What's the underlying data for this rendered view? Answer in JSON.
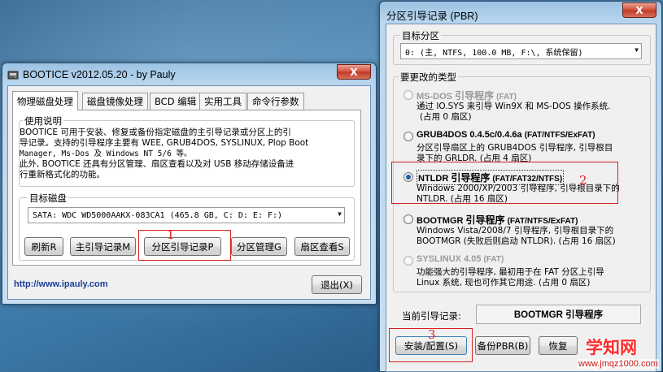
{
  "left_window": {
    "title": "BOOTICE v2012.05.20 - by Pauly",
    "close_label": "X",
    "tabs": [
      "物理磁盘处理",
      "磁盘镜像处理",
      "BCD 编辑",
      "实用工具",
      "命令行参数"
    ],
    "usage": {
      "label": "使用说明",
      "lines": [
        "BOOTICE 可用于安装、修复或备份指定磁盘的主引导记录或分区上的引",
        "导记录。支持的引导程序主要有 WEE, GRUB4DOS, SYSLINUX, Plop Boot",
        "Manager, Ms-Dos 及 Windows NT 5/6 等。",
        "此外, BOOTICE 还具有分区管理、扇区查看以及对 USB 移动存储设备进",
        "行重新格式化的功能。"
      ]
    },
    "target_disk": {
      "label": "目标磁盘",
      "value": "SATA: WDC WD5000AAKX-083CA1 (465.8 GB, C: D: E: F:)"
    },
    "buttons": {
      "refresh": "刷新R",
      "mbr": "主引导记录M",
      "pbr": "分区引导记录P",
      "partition": "分区管理G",
      "sector": "扇区查看S",
      "exit": "退出(X)"
    },
    "url": "http://www.ipauly.com",
    "annotation": "1"
  },
  "right_window": {
    "title": "分区引导记录 (PBR)",
    "close_label": "X",
    "target_partition": {
      "label": "目标分区",
      "value": "0: (主, NTFS, 100.0 MB, F:\\, 系统保留)"
    },
    "type_group_label": "要更改的类型",
    "options": [
      {
        "name": "MS-DOS",
        "cn": "引导程序",
        "fs": "(FAT)",
        "desc": [
          "通过 IO.SYS 来引导 Win9X 和 MS-DOS 操作系统.",
          "(占用 0 扇区)"
        ],
        "enabled": false,
        "checked": false
      },
      {
        "name": "GRUB4DOS 0.4.5c/0.4.6a",
        "cn": "",
        "fs": "(FAT/NTFS/ExFAT)",
        "desc": [
          "分区引导扇区上的 GRUB4DOS 引导程序, 引导根目",
          "录下的 GRLDR. (占用 4 扇区)"
        ],
        "enabled": true,
        "checked": false
      },
      {
        "name": "NTLDR",
        "cn": "引导程序",
        "fs": "(FAT/FAT32/NTFS)",
        "desc": [
          "Windows 2000/XP/2003 引导程序, 引导根目录下的",
          "NTLDR. (占用 16 扇区)"
        ],
        "enabled": true,
        "checked": true
      },
      {
        "name": "BOOTMGR",
        "cn": "引导程序",
        "fs": "(FAT/NTFS/ExFAT)",
        "desc": [
          "Windows Vista/2008/7 引导程序, 引导根目录下的",
          "BOOTMGR (失败后则启动 NTLDR). (占用 16 扇区)"
        ],
        "enabled": true,
        "checked": false
      },
      {
        "name": "SYSLINUX 4.05",
        "cn": "",
        "fs": "(FAT)",
        "desc": [
          "功能强大的引导程序, 最初用于在 FAT 分区上引导",
          "Linux 系统, 现也可作其它用途. (占用 0 扇区)"
        ],
        "enabled": false,
        "checked": false
      }
    ],
    "current_label": "当前引导记录:",
    "current_value": "BOOTMGR 引导程序",
    "buttons": {
      "install": "安装/配置(S)",
      "backup": "备份PBR(B)",
      "restore": "恢复"
    },
    "annotations": [
      "2",
      "3"
    ]
  },
  "watermark": {
    "title": "学知网",
    "url": "www.jmqz1000.com"
  }
}
